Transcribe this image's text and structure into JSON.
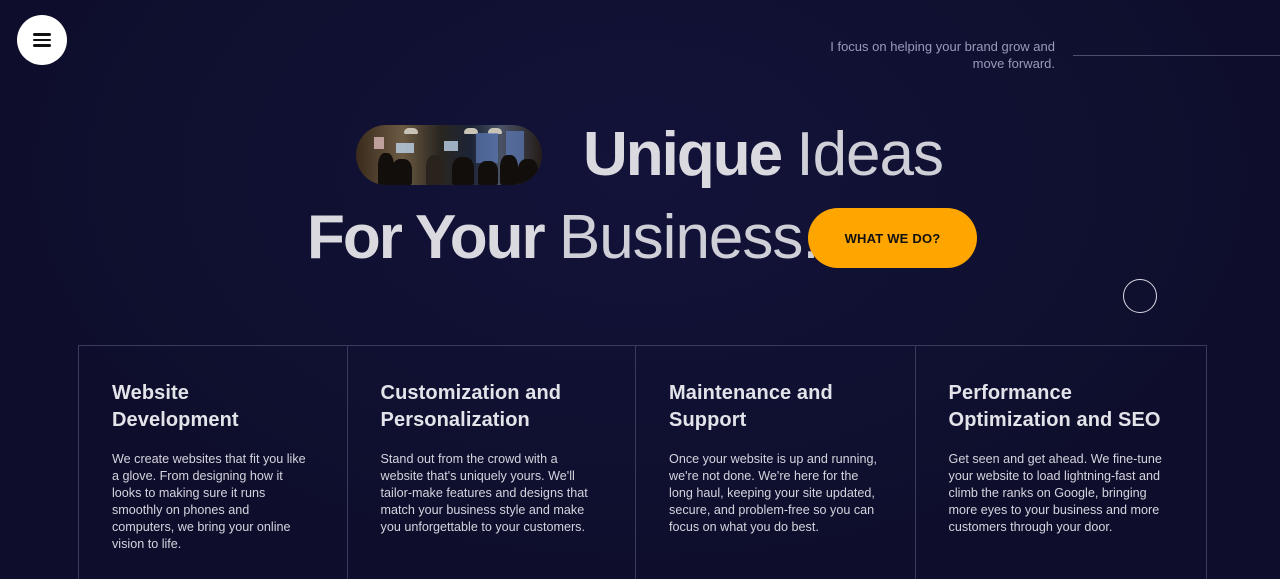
{
  "header": {
    "tagline": "I focus on helping your brand grow and move forward."
  },
  "hero": {
    "line1_bold": "Unique",
    "line1_thin": "Ideas",
    "line2_bold": "For Your",
    "line2_thin": "Business.",
    "cta_label": "WHAT WE DO?"
  },
  "services": [
    {
      "title": "Website Development",
      "description": "We create websites that fit you like a glove. From designing how it looks to making sure it runs smoothly on phones and computers, we bring your online vision to life."
    },
    {
      "title": "Customization and Personalization",
      "description": "Stand out from the crowd with a website that's uniquely yours. We'll tailor-make features and designs that match your business style and make you unforgettable to your customers."
    },
    {
      "title": "Maintenance and Support",
      "description": "Once your website is up and running, we're not done. We're here for the long haul, keeping your site updated, secure, and problem-free so you can focus on what you do best."
    },
    {
      "title": "Performance Optimization and SEO",
      "description": "Get seen and get ahead. We fine-tune your website to load lightning-fast and climb the ranks on Google, bringing more eyes to your business and more customers through your door."
    }
  ],
  "colors": {
    "background": "#0f0f2e",
    "accent": "#ffa500",
    "border": "#3a3a5e"
  },
  "icons": {
    "menu": "hamburger-menu-icon",
    "cursor": "cursor-ring-icon"
  }
}
